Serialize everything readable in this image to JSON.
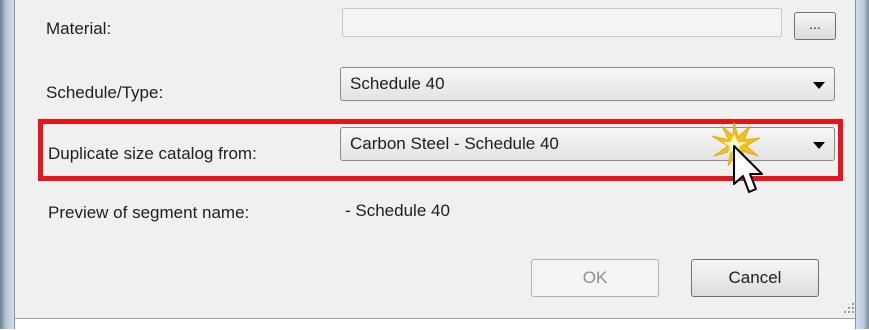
{
  "form": {
    "material_label": "Material:",
    "browse_label": "...",
    "schedule_label": "Schedule/Type:",
    "schedule_value": "Schedule 40",
    "duplicate_label": "Duplicate size catalog from:",
    "duplicate_value": "Carbon Steel - Schedule 40",
    "preview_label": "Preview of segment name:",
    "preview_value": "- Schedule 40"
  },
  "buttons": {
    "ok_label": "OK",
    "cancel_label": "Cancel"
  },
  "colors": {
    "highlight": "#e8141c",
    "dialog_bg": "#f0f0f0",
    "click_burst": "#f2c318"
  },
  "icons": {
    "dropdown": "chevron-down-icon",
    "cursor": "mouse-pointer-icon",
    "click": "click-burst-icon",
    "resize": "resize-grip-icon"
  },
  "state": {
    "ok_enabled": false,
    "material_enabled": false
  }
}
